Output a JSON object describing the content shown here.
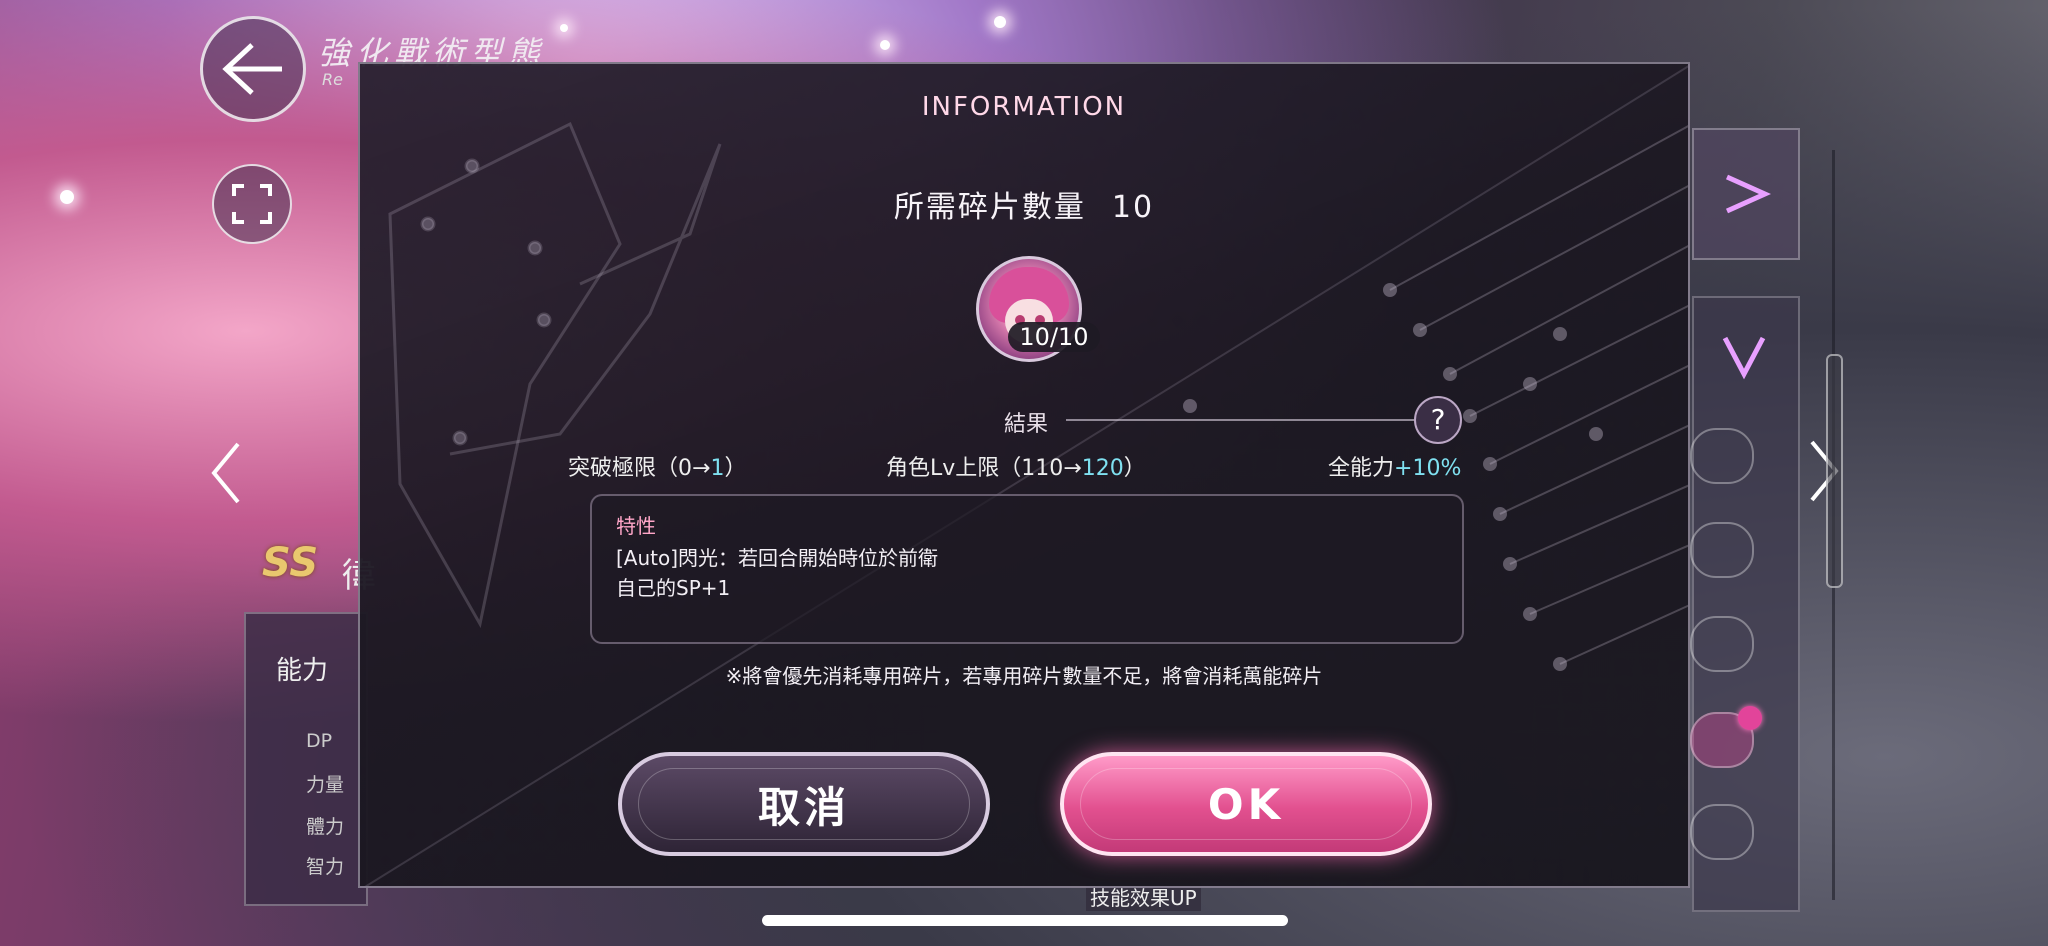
{
  "screen": {
    "mode_title": "強化戰術型態",
    "mode_subtitle": "Re",
    "ss_badge": "SS",
    "ss_char": "徫",
    "left_panel": {
      "header": "能力",
      "stats": [
        "DP",
        "力量",
        "體力",
        "智力"
      ]
    },
    "bottom_text": "技能效果UP"
  },
  "modal": {
    "title": "INFORMATION",
    "required_label": "所需碎片數量",
    "required_value": "10",
    "shard_count": "10/10",
    "result_label": "結果",
    "help_symbol": "?",
    "results": [
      {
        "label": "突破極限（0→",
        "value": "1",
        "suffix": "）"
      },
      {
        "label": "角色Lv上限（110→",
        "value": "120",
        "suffix": "）"
      },
      {
        "label": "全能力",
        "value": "+10%",
        "suffix": ""
      }
    ],
    "trait": {
      "title": "特性",
      "line1": "[Auto]閃光：若回合開始時位於前衛",
      "line2": "自己的SP+1"
    },
    "note": "※將會優先消耗專用碎片，若專用碎片數量不足，將會消耗萬能碎片",
    "cancel_label": "取消",
    "ok_label": "OK"
  },
  "colors": {
    "accent_pink": "#e2508f",
    "highlight_cyan": "#7fe0f0",
    "trait_title": "#ffa6c8"
  }
}
